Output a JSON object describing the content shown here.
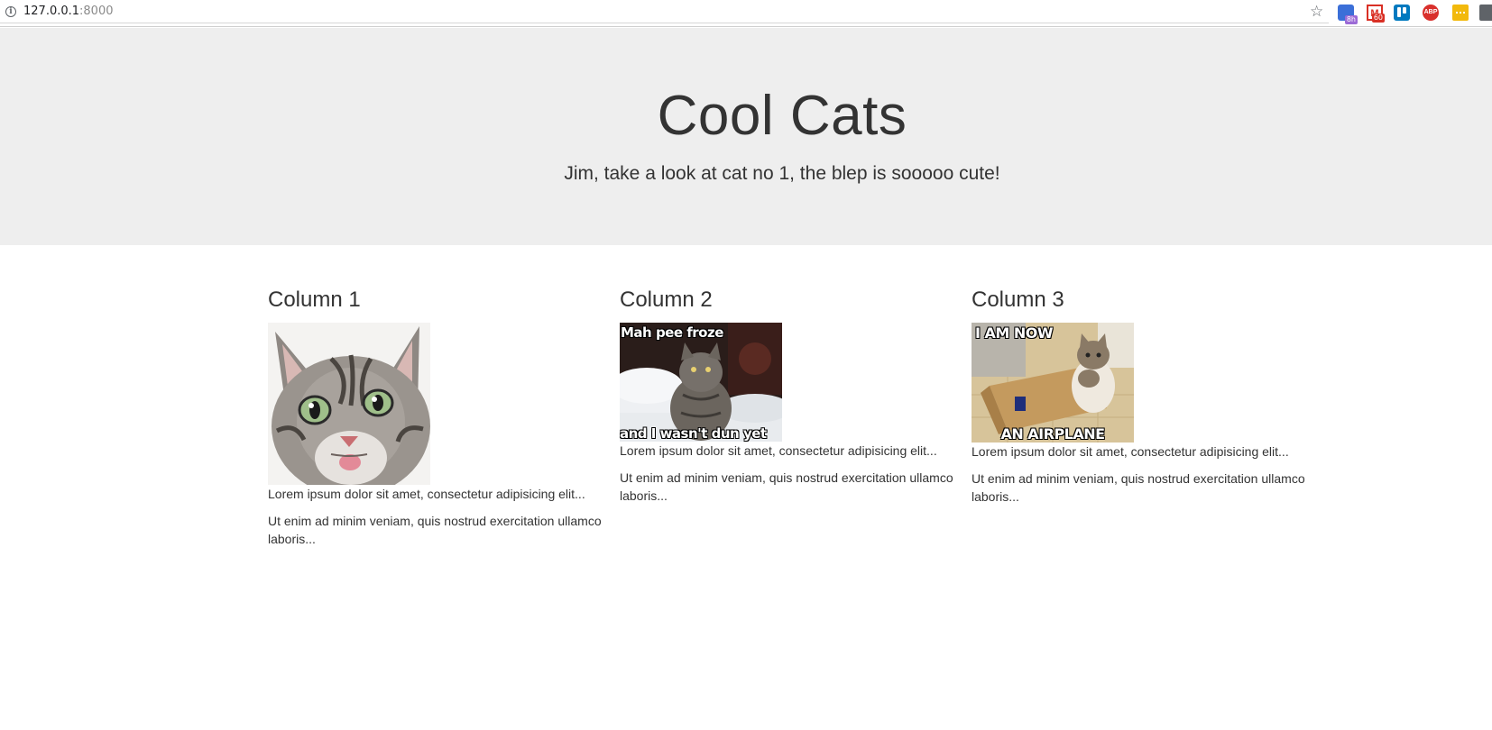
{
  "browser": {
    "url_host": "127.0.0.1",
    "url_port": ":8000",
    "extensions": [
      {
        "name": "calendar-extension",
        "badge": "8h"
      },
      {
        "name": "gmail-extension",
        "badge": "60"
      },
      {
        "name": "trello-extension",
        "badge": ""
      },
      {
        "name": "adblock-extension",
        "label": "ABP"
      },
      {
        "name": "keep-extension",
        "badge": ""
      }
    ]
  },
  "jumbotron": {
    "title": "Cool Cats",
    "subtitle": "Jim, take a look at cat no 1, the blep is sooooo cute!"
  },
  "columns": [
    {
      "heading": "Column 1",
      "image": {
        "kind": "cat-photo",
        "caption_top": "",
        "caption_bottom": ""
      },
      "p1": "Lorem ipsum dolor sit amet, consectetur adipisicing elit...",
      "p2": "Ut enim ad minim veniam, quis nostrud exercitation ullamco laboris..."
    },
    {
      "heading": "Column 2",
      "image": {
        "kind": "cat-meme",
        "caption_top": "Mah pee froze",
        "caption_bottom": "and I wasn't dun yet"
      },
      "p1": "Lorem ipsum dolor sit amet, consectetur adipisicing elit...",
      "p2": "Ut enim ad minim veniam, quis nostrud exercitation ullamco laboris..."
    },
    {
      "heading": "Column 3",
      "image": {
        "kind": "cat-meme",
        "caption_top": "I AM NOW",
        "caption_bottom": "AN AIRPLANE"
      },
      "p1": "Lorem ipsum dolor sit amet, consectetur adipisicing elit...",
      "p2": "Ut enim ad minim veniam, quis nostrud exercitation ullamco laboris..."
    }
  ],
  "colors": {
    "jumbotron_bg": "#eeeeee",
    "text": "#333333"
  }
}
